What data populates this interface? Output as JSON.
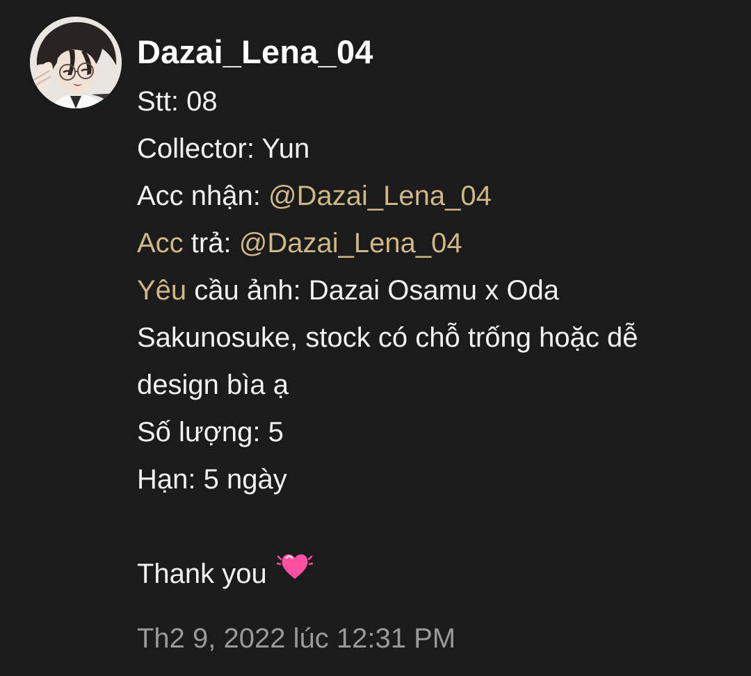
{
  "comment": {
    "author": "Dazai_Lena_04",
    "avatar_icon": "avatar-image",
    "lines": {
      "stt": "Stt: 08",
      "collector": "Collector: Yun",
      "acc_nhan_label": "Acc nhận: ",
      "acc_nhan_mention": "@Dazai_Lena_04",
      "acc_tra_label_gold": "Acc",
      "acc_tra_label_rest": " trả: ",
      "acc_tra_mention": "@Dazai_Lena_04",
      "yeu_cau_gold": "Yêu",
      "yeu_cau_rest": " cầu ảnh: Dazai Osamu x Oda Sakunosuke, stock có chỗ trống hoặc dễ design bìa ạ",
      "so_luong": "Số lượng: 5",
      "han": "Hạn: 5 ngày",
      "thanks": "Thank you"
    },
    "emoji": "beating-heart-icon",
    "timestamp": "Th2 9, 2022 lúc 12:31 PM"
  },
  "colors": {
    "background": "#1b1b1b",
    "text": "#f2f2f2",
    "mention": "#cfb787",
    "timestamp": "#9a9a9a",
    "heart": "#ff4fa3"
  }
}
